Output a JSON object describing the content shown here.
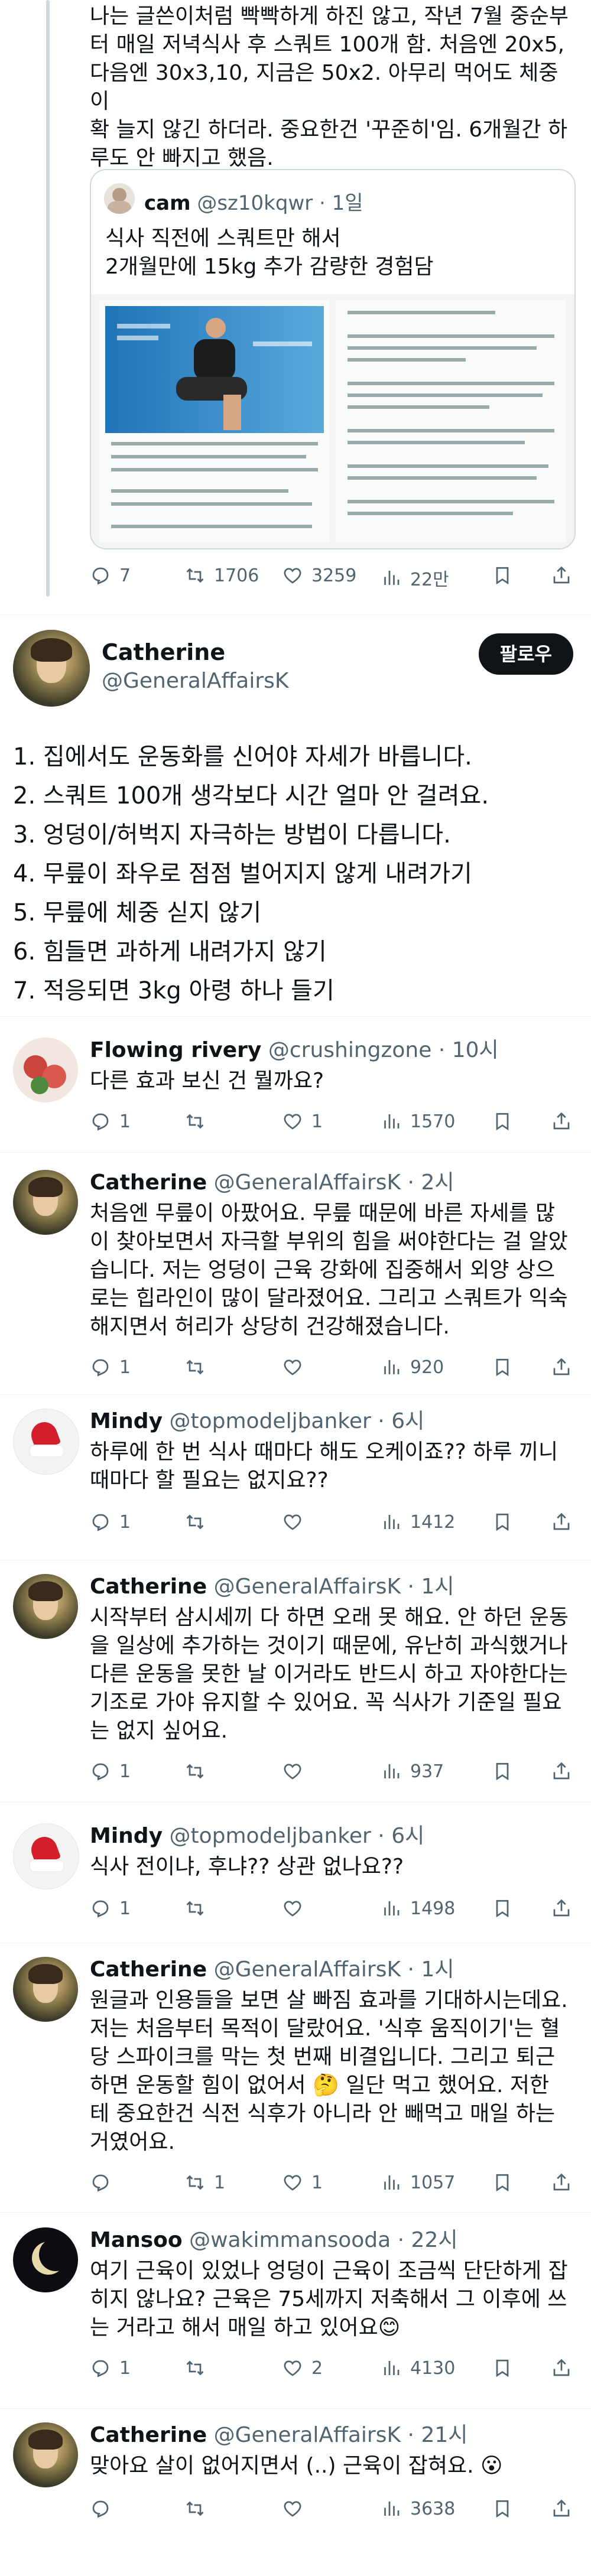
{
  "top_post": {
    "text_lines": [
      "나는 글쓴이처럼 빡빡하게 하진 않고, 작년 7월 중순부",
      "터 매일 저녁식사 후 스쿼트 100개 함. 처음엔 20x5,",
      "다음엔 30x3,10, 지금은 50x2. 아무리 먹어도 체중이",
      "확 늘지 않긴 하더라. 중요한건 '꾸준히'임. 6개월간 하",
      "루도 안 빠지고 했음."
    ],
    "quote": {
      "author": "cam",
      "handle": "@sz10kqwr",
      "dot": "·",
      "time": "1일",
      "text_lines": [
        "식사 직전에 스쿼트만 해서",
        "2개월만에 15kg 추가 감량한 경험담"
      ]
    },
    "actions": {
      "replies": "7",
      "retweets": "1706",
      "likes": "3259",
      "views": "22만"
    }
  },
  "main_post": {
    "name": "Catherine",
    "handle": "@GeneralAffairsK",
    "follow_label": "팔로우",
    "lines": [
      "1. 집에서도 운동화를 신어야 자세가 바릅니다.",
      "2. 스쿼트 100개 생각보다 시간 얼마 안 걸려요.",
      "3. 엉덩이/허벅지 자극하는 방법이 다릅니다.",
      "4. 무릎이 좌우로 점점 벌어지지 않게 내려가기",
      "5. 무릎에 체중 싣지 않기",
      "6. 힘들면 과하게 내려가지 않기",
      "7. 적응되면 3kg 아령 하나 들기"
    ]
  },
  "replies": [
    {
      "name": "Flowing rivery",
      "handle": "@crushingzone",
      "dot": "·",
      "time": "10시",
      "lines": [
        "다른 효과 보신 건 뭘까요?"
      ],
      "actions": {
        "replies": "1",
        "retweets": "",
        "likes": "1",
        "views": "1570"
      }
    },
    {
      "name": "Catherine",
      "handle": "@GeneralAffairsK",
      "dot": "·",
      "time": "2시",
      "lines": [
        "처음엔 무릎이 아팠어요. 무릎 때문에 바른 자세를 많",
        "이 찾아보면서 자극할 부위의 힘을 써야한다는 걸 알았",
        "습니다. 저는 엉덩이 근육 강화에 집중해서 외양 상으",
        "로는 힙라인이 많이 달라졌어요. 그리고 스쿼트가 익숙",
        "해지면서 허리가 상당히 건강해졌습니다."
      ],
      "actions": {
        "replies": "1",
        "retweets": "",
        "likes": "",
        "views": "920"
      }
    },
    {
      "name": "Mindy",
      "handle": "@topmodeljbanker",
      "dot": "·",
      "time": "6시",
      "lines": [
        "하루에 한 번 식사 때마다 해도 오케이죠?? 하루 끼니",
        "때마다 할 필요는 없지요??"
      ],
      "actions": {
        "replies": "1",
        "retweets": "",
        "likes": "",
        "views": "1412"
      }
    },
    {
      "name": "Catherine",
      "handle": "@GeneralAffairsK",
      "dot": "·",
      "time": "1시",
      "lines": [
        "시작부터 삼시세끼 다 하면 오래 못 해요. 안 하던 운동",
        "을 일상에 추가하는 것이기 때문에, 유난히 과식했거나",
        "다른 운동을 못한 날 이거라도 반드시 하고 자야한다는",
        "기조로 가야 유지할 수 있어요. 꼭 식사가 기준일 필요",
        "는 없지 싶어요."
      ],
      "actions": {
        "replies": "1",
        "retweets": "",
        "likes": "",
        "views": "937"
      }
    },
    {
      "name": "Mindy",
      "handle": "@topmodeljbanker",
      "dot": "·",
      "time": "6시",
      "lines": [
        "식사 전이냐, 후냐?? 상관 없나요??"
      ],
      "actions": {
        "replies": "1",
        "retweets": "",
        "likes": "",
        "views": "1498"
      }
    },
    {
      "name": "Catherine",
      "handle": "@GeneralAffairsK",
      "dot": "·",
      "time": "1시",
      "lines": [
        "원글과 인용들을 보면 살 빠짐 효과를 기대하시는데요.",
        "저는 처음부터 목적이 달랐어요. '식후 움직이기'는 혈",
        "당 스파이크를 막는 첫 번째 비결입니다. 그리고 퇴근",
        "하면 운동할 힘이 없어서 🤔 일단 먹고 했어요. 저한",
        "테 중요한건 식전 식후가 아니라 안 빼먹고 매일 하는",
        "거였어요."
      ],
      "actions": {
        "replies": "",
        "retweets": "1",
        "likes": "1",
        "views": "1057"
      }
    },
    {
      "name": "Mansoo",
      "handle": "@wakimmansooda",
      "dot": "·",
      "time": "22시",
      "lines": [
        "여기 근육이 있었나 엉덩이 근육이 조금씩 단단하게 잡",
        "히지 않나요? 근육은 75세까지 저축해서 그 이후에 쓰",
        "는 거라고 해서 매일 하고 있어요😊"
      ],
      "actions": {
        "replies": "1",
        "retweets": "",
        "likes": "2",
        "views": "4130"
      }
    },
    {
      "name": "Catherine",
      "handle": "@GeneralAffairsK",
      "dot": "·",
      "time": "21시",
      "lines": [
        "맞아요 살이 없어지면서 (..) 근육이 잡혀요. 😮"
      ],
      "actions": {
        "replies": "",
        "retweets": "",
        "likes": "",
        "views": "3638"
      }
    }
  ],
  "icons": {
    "reply": "reply-icon",
    "retweet": "retweet-icon",
    "like": "heart-icon",
    "views": "views-icon",
    "bookmark": "bookmark-icon",
    "share": "share-icon"
  },
  "colors": {
    "text": "#0f1419",
    "muted": "#536471",
    "border": "#cfd9de",
    "divider": "#eff3f4"
  }
}
